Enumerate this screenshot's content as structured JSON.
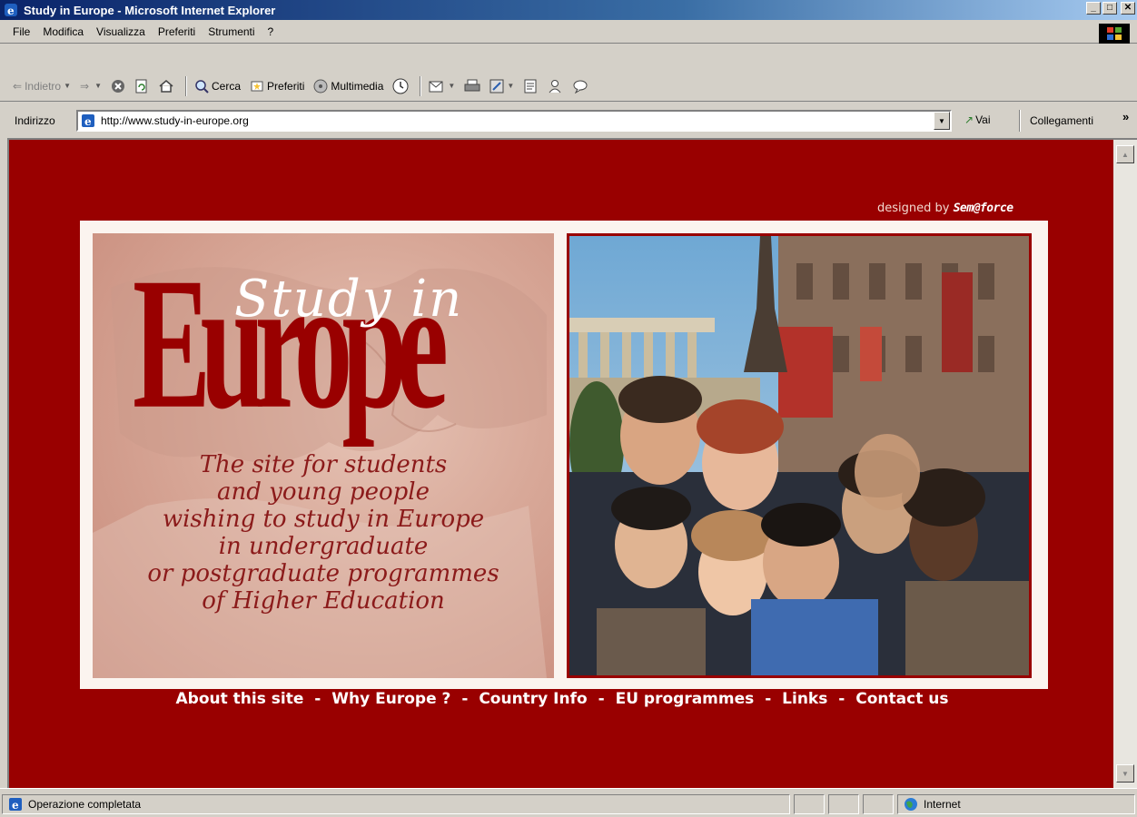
{
  "window": {
    "title": "Study in Europe - Microsoft Internet Explorer",
    "min_label": "_",
    "max_label": "□",
    "close_label": "✕"
  },
  "menu": [
    "File",
    "Modifica",
    "Visualizza",
    "Preferiti",
    "Strumenti",
    "?"
  ],
  "toolbar": {
    "back": "Indietro",
    "search": "Cerca",
    "favorites": "Preferiti",
    "media": "Multimedia"
  },
  "address": {
    "label": "Indirizzo",
    "url": "http://www.study-in-europe.org",
    "go": "Vai",
    "links": "Collegamenti",
    "more": "»"
  },
  "page": {
    "designed_prefix": "designed by",
    "designed_brand": "Sem@force",
    "headline_study": "Study in",
    "headline_europe": "Europe",
    "tagline": [
      "The site for students",
      "and young people",
      "wishing to study in Europe",
      "in undergraduate",
      "or postgraduate programmes",
      "of Higher Education"
    ],
    "nav": [
      "About this site",
      "Why Europe ?",
      "Country Info",
      "EU programmes",
      "Links",
      "Contact us"
    ],
    "nav_sep": "-"
  },
  "status": {
    "text": "Operazione completata",
    "zone": "Internet"
  },
  "colors": {
    "page_bg": "#990000",
    "accent": "#990000",
    "text_light": "#ffffff"
  }
}
